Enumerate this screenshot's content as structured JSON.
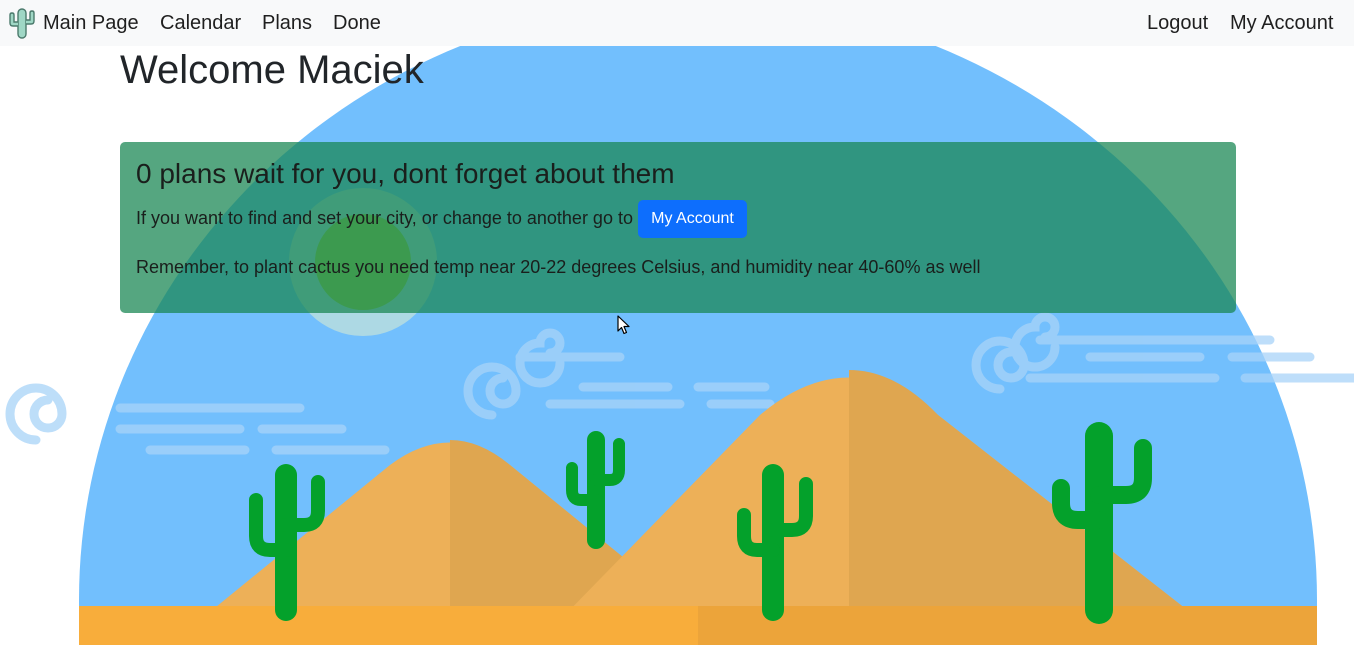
{
  "navbar": {
    "brand_icon": "cactus-icon",
    "left_items": [
      "Main Page",
      "Calendar",
      "Plans",
      "Done"
    ],
    "right_items": [
      "Logout",
      "My Account"
    ]
  },
  "main": {
    "title": "Welcome Maciek",
    "alert": {
      "heading": "0 plans wait for you, dont forget about them",
      "line1": "If you want to find and set your city, or change to another go to",
      "button_label": "My Account",
      "line2": "Remember, to plant cactus you need temp near 20-22 degrees Celsius, and humidity near 40-60% as well"
    }
  },
  "background": {
    "illustration": "desert-cactus-illustration",
    "colors": {
      "sky": "#72bffd",
      "sand": "#eeae56",
      "cactus": "#04a12b",
      "ground": "#f8ad3b"
    }
  },
  "colors": {
    "navbar_bg": "#f8f9fa",
    "alert_bg": "#198754",
    "button_bg": "#0d6efd"
  }
}
